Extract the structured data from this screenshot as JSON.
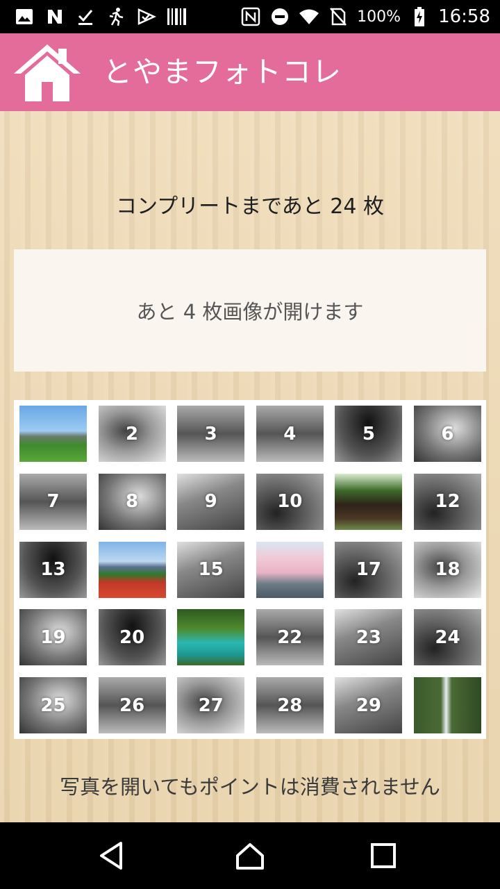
{
  "status_bar": {
    "battery_percent": "100%",
    "time": "16:58",
    "left_icons": [
      "image-icon",
      "n-logo-icon",
      "download-done-icon",
      "runner-icon",
      "check-icon",
      "barcode-icon"
    ],
    "right_icons": [
      "nfc-icon",
      "do-not-disturb-icon",
      "wifi-icon",
      "no-sim-icon",
      "battery-charging-icon"
    ]
  },
  "app_bar": {
    "title": "とやまフォトコレ",
    "color": "#e46c9b"
  },
  "main": {
    "remaining_text": "コンプリートまであと 24 枚",
    "info_text": "あと 4 枚画像が開けます",
    "notice_text": "写真を開いてもポイントは消費されません"
  },
  "tiles": [
    {
      "label": "",
      "photo": "bridge"
    },
    {
      "label": "2",
      "gradient": "g0"
    },
    {
      "label": "3",
      "gradient": "g1"
    },
    {
      "label": "4",
      "gradient": "g1"
    },
    {
      "label": "5",
      "gradient": "g5"
    },
    {
      "label": "6",
      "gradient": "g2"
    },
    {
      "label": "7",
      "gradient": "g1"
    },
    {
      "label": "8",
      "gradient": "g2"
    },
    {
      "label": "9",
      "gradient": "g4"
    },
    {
      "label": "10",
      "gradient": "g3"
    },
    {
      "label": "",
      "photo": "house"
    },
    {
      "label": "12",
      "gradient": "g3"
    },
    {
      "label": "13",
      "gradient": "g5"
    },
    {
      "label": "",
      "photo": "tulip"
    },
    {
      "label": "15",
      "gradient": "g4"
    },
    {
      "label": "",
      "photo": "sakura"
    },
    {
      "label": "17",
      "gradient": "g3"
    },
    {
      "label": "18",
      "gradient": "g0"
    },
    {
      "label": "19",
      "gradient": "g2"
    },
    {
      "label": "20",
      "gradient": "g5"
    },
    {
      "label": "",
      "photo": "river"
    },
    {
      "label": "22",
      "gradient": "g1"
    },
    {
      "label": "23",
      "gradient": "g4"
    },
    {
      "label": "24",
      "gradient": "g3"
    },
    {
      "label": "25",
      "gradient": "g2"
    },
    {
      "label": "26",
      "gradient": "g1"
    },
    {
      "label": "27",
      "gradient": "g0"
    },
    {
      "label": "28",
      "gradient": "g1"
    },
    {
      "label": "29",
      "gradient": "g4"
    },
    {
      "label": "",
      "photo": "fall"
    }
  ],
  "nav_bar": {
    "buttons": [
      "back-icon",
      "home-icon",
      "recents-icon"
    ]
  }
}
